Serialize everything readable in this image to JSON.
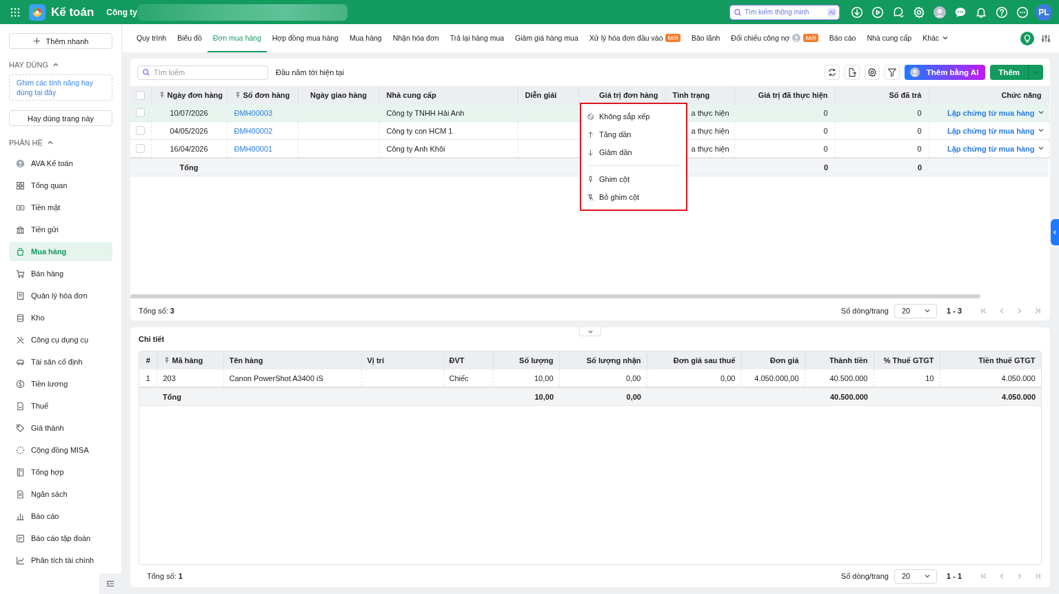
{
  "header": {
    "app_title": "Kế toán",
    "company": "Công ty",
    "search_placeholder": "Tìm kiếm thông minh",
    "ai_badge": "AI",
    "user_initials": "PL"
  },
  "sidebar": {
    "quick_add": "Thêm nhanh",
    "favorites_title": "HAY DÙNG",
    "favorites_hint": "Ghim các tính năng hay dùng tại đây",
    "favorites_button": "Hay dùng trang này",
    "modules_title": "PHÂN HỆ",
    "items": [
      {
        "label": "AVA Kế toán",
        "selected": false
      },
      {
        "label": "Tổng quan",
        "selected": false
      },
      {
        "label": "Tiền mặt",
        "selected": false
      },
      {
        "label": "Tiền gửi",
        "selected": false
      },
      {
        "label": "Mua hàng",
        "selected": true
      },
      {
        "label": "Bán hàng",
        "selected": false
      },
      {
        "label": "Quản lý hóa đơn",
        "selected": false
      },
      {
        "label": "Kho",
        "selected": false
      },
      {
        "label": "Công cụ dụng cụ",
        "selected": false
      },
      {
        "label": "Tài sản cố định",
        "selected": false
      },
      {
        "label": "Tiền lương",
        "selected": false
      },
      {
        "label": "Thuế",
        "selected": false
      },
      {
        "label": "Giá thành",
        "selected": false
      },
      {
        "label": "Cộng đồng MISA",
        "selected": false
      },
      {
        "label": "Tổng hợp",
        "selected": false
      },
      {
        "label": "Ngân sách",
        "selected": false
      },
      {
        "label": "Báo cáo",
        "selected": false
      },
      {
        "label": "Báo cáo tập đoàn",
        "selected": false
      },
      {
        "label": "Phân tích tài chính",
        "selected": false
      }
    ]
  },
  "tabs": [
    {
      "label": "Quy trình",
      "selected": false
    },
    {
      "label": "Biểu đồ",
      "selected": false
    },
    {
      "label": "Đơn mua hàng",
      "selected": true
    },
    {
      "label": "Hợp đồng mua hàng",
      "selected": false
    },
    {
      "label": "Mua hàng",
      "selected": false
    },
    {
      "label": "Nhận hóa đơn",
      "selected": false
    },
    {
      "label": "Trả lại hàng mua",
      "selected": false
    },
    {
      "label": "Giảm giá hàng mua",
      "selected": false
    },
    {
      "label": "Xử lý hóa đơn đầu vào",
      "selected": false,
      "badge": "Mới"
    },
    {
      "label": "Bảo lãnh",
      "selected": false
    },
    {
      "label": "Đối chiếu công nợ",
      "selected": false,
      "avatar": true,
      "badge": "Mới"
    },
    {
      "label": "Báo cáo",
      "selected": false
    },
    {
      "label": "Nhà cung cấp",
      "selected": false
    },
    {
      "label": "Khác",
      "selected": false,
      "dropdown": true
    }
  ],
  "toolbar": {
    "search_placeholder": "Tìm kiếm",
    "period": "Đầu năm tới hiện tại",
    "ai_button": "Thêm bằng AI",
    "add_button": "Thêm"
  },
  "orders": {
    "select_all_checked": false,
    "columns": [
      {
        "label": "Ngày đơn hàng",
        "pinned": true
      },
      {
        "label": "Số đơn hàng",
        "pinned": true
      },
      {
        "label": "Ngày giao hàng",
        "pinned": false
      },
      {
        "label": "Nhà cung cấp",
        "pinned": false
      },
      {
        "label": "Diễn giải",
        "pinned": false
      },
      {
        "label": "Giá trị đơn hàng",
        "pinned": false
      },
      {
        "label": "Tình trạng",
        "pinned": false
      },
      {
        "label": "Giá trị đã thực hiện",
        "pinned": false
      },
      {
        "label": "Số đã trả",
        "pinned": false
      },
      {
        "label": "Chức năng",
        "pinned": false
      }
    ],
    "rows": [
      {
        "selected": true,
        "checked": false,
        "date": "10/07/2026",
        "number": "ĐMH00003",
        "supplier": "Công ty TNHH Hải Anh",
        "status": "a thực hiện",
        "done_value": "0",
        "paid": "0",
        "action": "Lập chứng từ mua hàng"
      },
      {
        "selected": false,
        "checked": false,
        "date": "04/05/2026",
        "number": "ĐMH00002",
        "supplier": "Công ty con HCM 1",
        "status": "a thực hiện",
        "done_value": "0",
        "paid": "0",
        "action": "Lập chứng từ mua hàng"
      },
      {
        "selected": false,
        "checked": false,
        "date": "16/04/2026",
        "number": "ĐMH00001",
        "supplier": "Công ty Anh Khôi",
        "status": "a thực hiện",
        "done_value": "0",
        "paid": "0",
        "action": "Lập chứng từ mua hàng"
      }
    ],
    "totals": {
      "label": "Tổng",
      "done_value": "0",
      "paid": "0"
    },
    "pagination": {
      "total_label": "Tổng số:",
      "total": "3",
      "page_size_label": "Số dòng/trang",
      "page_size": "20",
      "range": "1 - 3"
    }
  },
  "sort_menu": {
    "groups": [
      [
        {
          "label": "Không sắp xếp"
        },
        {
          "label": "Tăng dần"
        },
        {
          "label": "Giảm dần"
        }
      ],
      [
        {
          "label": "Ghim cột"
        },
        {
          "label": "Bỏ ghim cột"
        }
      ]
    ]
  },
  "detail": {
    "title": "Chi tiết",
    "columns": [
      {
        "label": "#",
        "pinned": false
      },
      {
        "label": "Mã hàng",
        "pinned": true
      },
      {
        "label": "Tên hàng",
        "pinned": false
      },
      {
        "label": "Vị trí",
        "pinned": false
      },
      {
        "label": "ĐVT",
        "pinned": false
      },
      {
        "label": "Số lượng",
        "pinned": false
      },
      {
        "label": "Số lượng nhận",
        "pinned": false
      },
      {
        "label": "Đơn giá sau thuế",
        "pinned": false
      },
      {
        "label": "Đơn giá",
        "pinned": false
      },
      {
        "label": "Thành tiền",
        "pinned": false
      },
      {
        "label": "% Thuế GTGT",
        "pinned": false
      },
      {
        "label": "Tiền thuế GTGT",
        "pinned": false
      }
    ],
    "rows": [
      [
        "1",
        "203",
        "Canon PowerShot A3400 iS",
        "",
        "Chiếc",
        "10,00",
        "0,00",
        "0,00",
        "4.050.000,00",
        "40.500.000",
        "10",
        "4.050.000"
      ]
    ],
    "totals": {
      "label": "Tổng",
      "quantity": "10,00",
      "received": "0,00",
      "amount": "40.500.000",
      "vat_amount": "4.050.000"
    },
    "pagination": {
      "total_label": "Tổng số:",
      "total": "1",
      "page_size_label": "Số dòng/trang",
      "page_size": "20",
      "range": "1 - 1"
    }
  }
}
